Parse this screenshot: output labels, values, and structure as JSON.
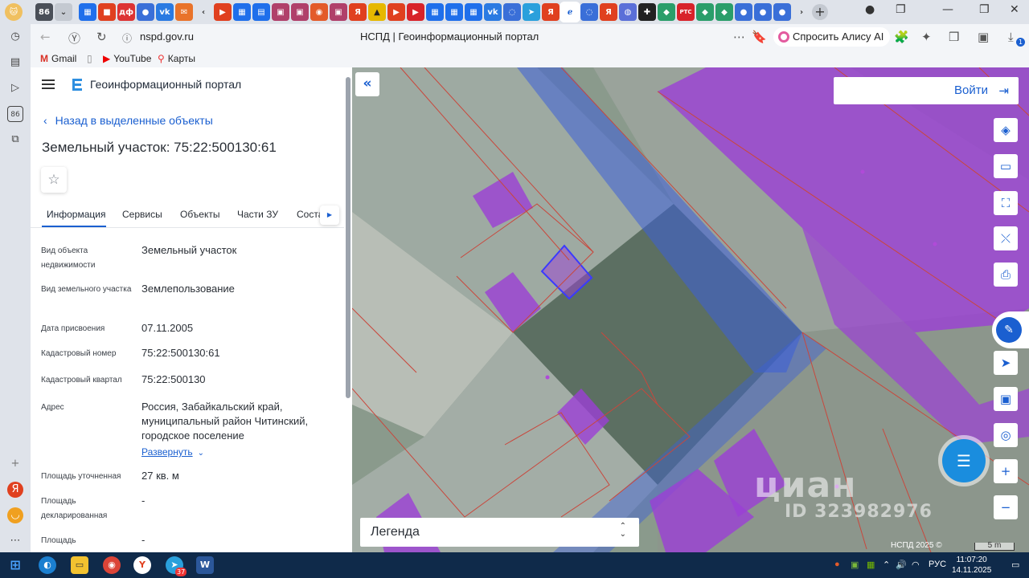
{
  "browser": {
    "tab_count_badge": "86",
    "url": "nspd.gov.ru",
    "page_title": "НСПД | Геоинформационный портал",
    "alice_button": "Спросить Алису AI",
    "bookmarks": [
      "Gmail",
      "YouTube",
      "Карты"
    ],
    "leftbar_badge": "86",
    "extensions_badge": "1"
  },
  "portal": {
    "title": "Геоинформационный портал",
    "back_link": "Назад в выделенные объекты",
    "object_title": "Земельный участок: 75:22:500130:61",
    "tabs": [
      "Информация",
      "Сервисы",
      "Объекты",
      "Части ЗУ",
      "Соста"
    ],
    "properties": [
      {
        "label": "Вид объекта недвижимости",
        "value": "Земельный участок"
      },
      {
        "label": "Вид земельного участка",
        "value": "Землепользование"
      },
      {
        "label": "Дата присвоения",
        "value": "07.11.2005"
      },
      {
        "label": "Кадастровый номер",
        "value": "75:22:500130:61"
      },
      {
        "label": "Кадастровый квартал",
        "value": "75:22:500130"
      },
      {
        "label": "Адрес",
        "value": "Россия, Забайкальский край, муниципальный район Читинский, городское поселение"
      },
      {
        "label": "Площадь уточненная",
        "value": "27 кв. м"
      },
      {
        "label": "Площадь декларированная",
        "value": "-"
      },
      {
        "label": "Площадь",
        "value": "-"
      }
    ],
    "expand_link": "Развернуть"
  },
  "map": {
    "login": "Войти",
    "legend": "Легенда",
    "attribution": "НСПД 2025 ©",
    "scale": "5 m",
    "watermark": "циан",
    "watermark_id": "ID 323982976"
  },
  "taskbar": {
    "telegram_badge": "37",
    "lang": "РУС",
    "time": "11:07:20",
    "date": "14.11.2025"
  },
  "colors": {
    "accent": "#1a5fd0",
    "parcel_purple": "#9b3fd6",
    "road_blue": "#3c5fd8",
    "boundary_red": "#c9473c"
  }
}
